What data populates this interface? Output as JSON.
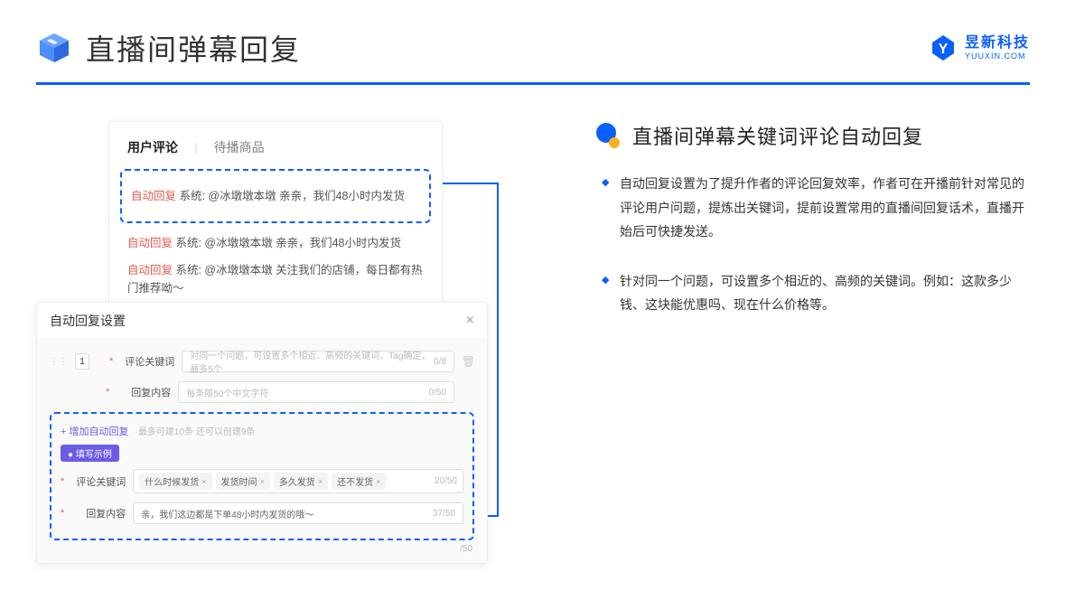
{
  "header": {
    "title": "直播间弹幕回复",
    "brand_zh": "昱新科技",
    "brand_en": "YUUXIN.COM"
  },
  "comment_panel": {
    "tab1": "用户评论",
    "tab2": "待播商品",
    "highlighted": "自动回复 系统: @冰墩墩本墩 亲亲，我们48小时内发货",
    "line2_tag": "自动回复",
    "line2_text": " 系统: @冰墩墩本墩 亲亲，我们48小时内发货",
    "line3_tag": "自动回复",
    "line3_text": " 系统: @冰墩墩本墩 关注我们的店铺，每日都有热门推荐呦～"
  },
  "settings": {
    "title": "自动回复设置",
    "num": "1",
    "label_keyword": "评论关键词",
    "placeholder_keyword": "对同一个问题，可设置多个相近、高频的关键词，Tag确定，最多5个",
    "counter_keyword": "0/8",
    "label_content": "回复内容",
    "placeholder_content": "每条限50个中文字符",
    "counter_content": "0/50",
    "add_link": "+ 增加自动回复",
    "add_note": "最多可建10条 还可以创建9条",
    "example_chip": "● 填写示例",
    "example_label_keyword": "评论关键词",
    "tag1": "什么时候发货",
    "tag2": "发货时间",
    "tag3": "多久发货",
    "tag4": "还不发货",
    "example_counter1": "20/50",
    "example_label_content": "回复内容",
    "example_content": "亲，我们这边都是下单48小时内发货的哦～",
    "example_counter2": "37/50",
    "side_counter": "/50"
  },
  "right": {
    "section_title": "直播间弹幕关键词评论自动回复",
    "bullet1": "自动回复设置为了提升作者的评论回复效率，作者可在开播前针对常见的评论用户问题，提炼出关键词，提前设置常用的直播间回复话术，直播开始后可快捷发送。",
    "bullet2": "针对同一个问题，可设置多个相近的、高频的关键词。例如：这款多少钱、这块能优惠吗、现在什么价格等。"
  }
}
